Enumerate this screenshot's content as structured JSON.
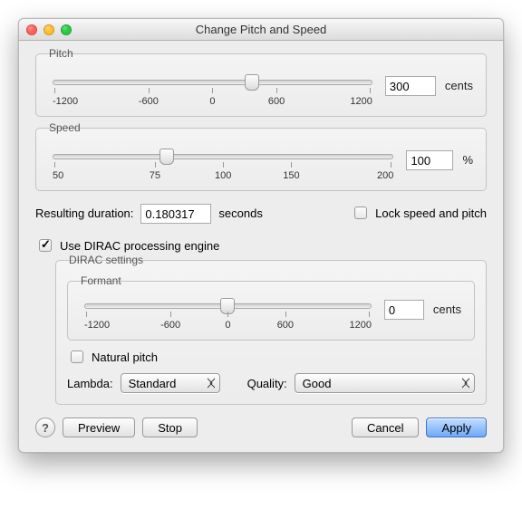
{
  "window": {
    "title": "Change Pitch and Speed"
  },
  "pitch": {
    "legend": "Pitch",
    "ticks": [
      "-1200",
      "-600",
      "0",
      "600",
      "1200"
    ],
    "value": "300",
    "unit": "cents",
    "thumb_pct": 62.5
  },
  "speed": {
    "legend": "Speed",
    "ticks": [
      "50",
      "75",
      "100",
      "150",
      "200"
    ],
    "value": "100",
    "unit": "%",
    "thumb_pct": 33.3
  },
  "duration": {
    "label": "Resulting duration:",
    "value": "0.180317",
    "unit": "seconds"
  },
  "lock": {
    "label": "Lock speed and pitch",
    "checked": false
  },
  "dirac": {
    "use_label": "Use DIRAC processing engine",
    "use_checked": true,
    "legend": "DIRAC settings",
    "formant": {
      "legend": "Formant",
      "ticks": [
        "-1200",
        "-600",
        "0",
        "600",
        "1200"
      ],
      "value": "0",
      "unit": "cents",
      "thumb_pct": 50
    },
    "natural": {
      "label": "Natural pitch",
      "checked": false
    },
    "lambda": {
      "label": "Lambda:",
      "value": "Standard"
    },
    "quality": {
      "label": "Quality:",
      "value": "Good"
    }
  },
  "buttons": {
    "preview": "Preview",
    "stop": "Stop",
    "cancel": "Cancel",
    "apply": "Apply"
  }
}
